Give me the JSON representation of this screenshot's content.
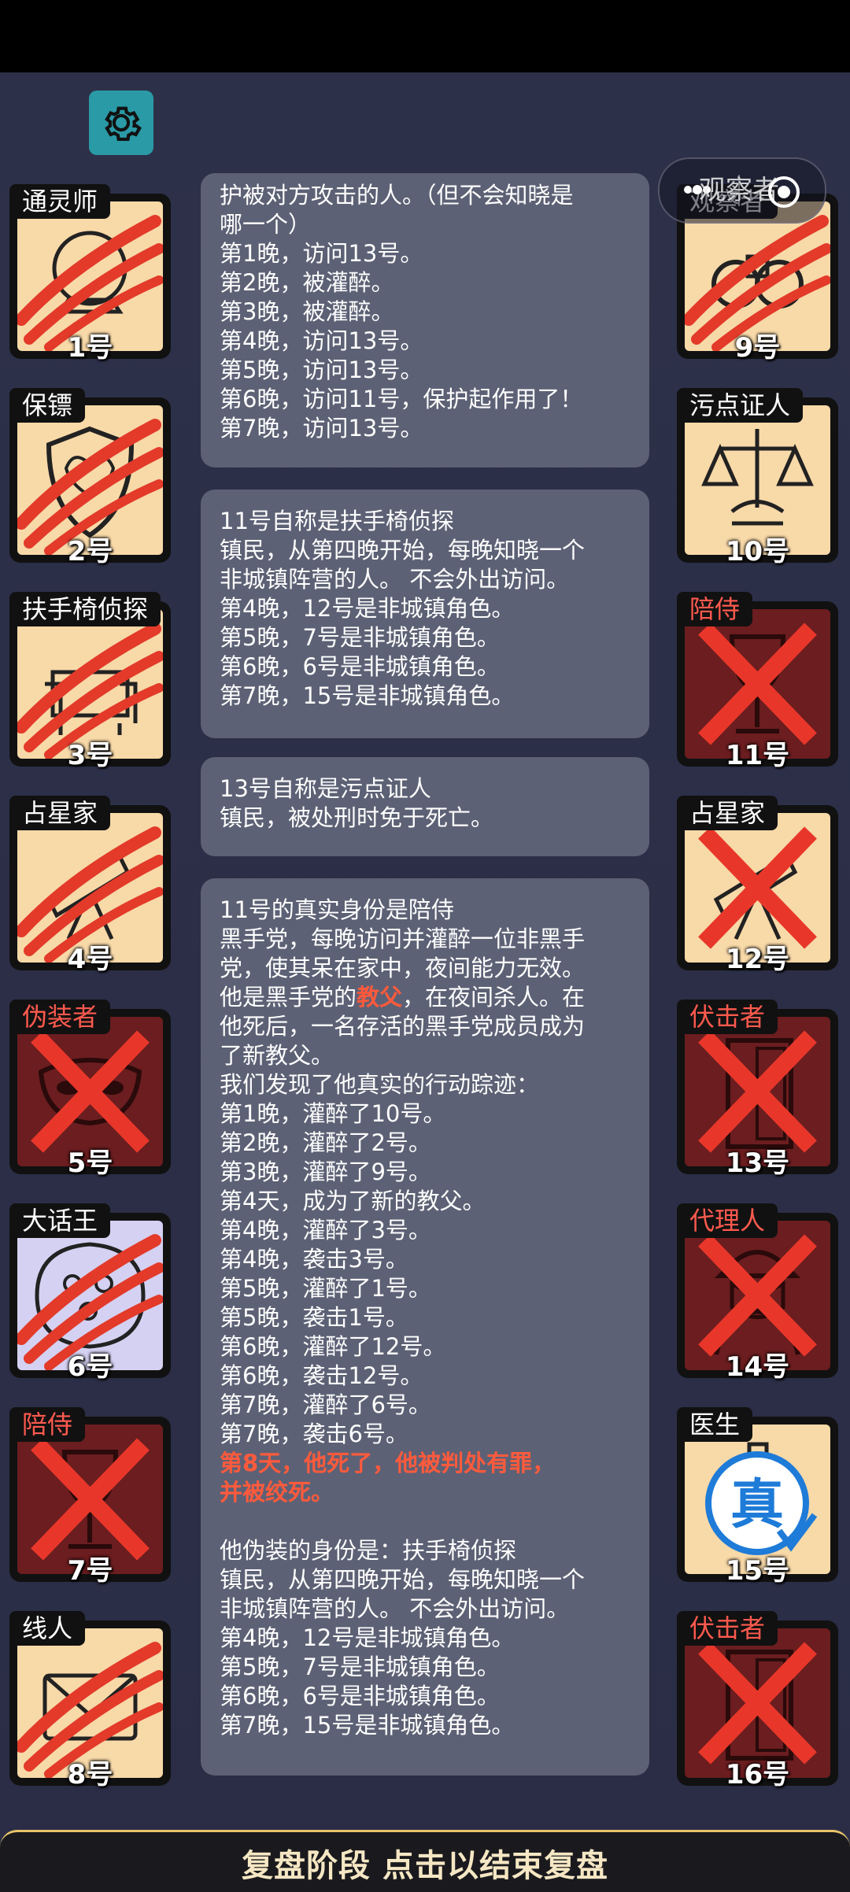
{
  "observer": {
    "label": "观察者"
  },
  "players_left": [
    {
      "num": "1号",
      "role": "通灵师",
      "evil": false,
      "state": "scratched",
      "icon": "crystal-ball-icon"
    },
    {
      "num": "2号",
      "role": "保镖",
      "evil": false,
      "state": "scratched",
      "icon": "shield-icon"
    },
    {
      "num": "3号",
      "role": "扶手椅侦探",
      "evil": false,
      "state": "scratched",
      "icon": "armchair-icon"
    },
    {
      "num": "4号",
      "role": "占星家",
      "evil": false,
      "state": "scratched",
      "icon": "telescope-icon"
    },
    {
      "num": "5号",
      "role": "伪装者",
      "evil": true,
      "state": "crossed",
      "icon": "mask-icon"
    },
    {
      "num": "6号",
      "role": "大话王",
      "evil": false,
      "state": "scratched",
      "icon": "speech-icon"
    },
    {
      "num": "7号",
      "role": "陪侍",
      "evil": true,
      "state": "crossed",
      "icon": "wine-glass-icon"
    },
    {
      "num": "8号",
      "role": "线人",
      "evil": false,
      "state": "scratched",
      "icon": "envelope-icon"
    }
  ],
  "players_right": [
    {
      "num": "9号",
      "role": "观察者",
      "evil": false,
      "state": "scratched",
      "icon": "binoculars-icon"
    },
    {
      "num": "10号",
      "role": "污点证人",
      "evil": false,
      "state": "alive",
      "icon": "scales-icon"
    },
    {
      "num": "11号",
      "role": "陪侍",
      "evil": true,
      "state": "crossed",
      "icon": "wine-glass-icon"
    },
    {
      "num": "12号",
      "role": "占星家",
      "evil": false,
      "state": "crossed",
      "icon": "telescope-icon"
    },
    {
      "num": "13号",
      "role": "伏击者",
      "evil": true,
      "state": "crossed",
      "icon": "door-icon"
    },
    {
      "num": "14号",
      "role": "代理人",
      "evil": true,
      "state": "crossed",
      "icon": "agent-icon"
    },
    {
      "num": "15号",
      "role": "医生",
      "evil": false,
      "state": "true-stamp",
      "icon": "syringe-icon",
      "stamp": "真"
    },
    {
      "num": "16号",
      "role": "伏击者",
      "evil": true,
      "state": "crossed",
      "icon": "door-icon"
    }
  ],
  "log": {
    "bubble1": [
      "护被对方攻击的人。（但不会知晓是",
      "哪一个）",
      "第1晚，访问13号。",
      "第2晚，被灌醉。",
      "第3晚，被灌醉。",
      "第4晚，访问13号。",
      "第5晚，访问13号。",
      "第6晚，访问11号，保护起作用了！",
      "第7晚，访问13号。"
    ],
    "bubble2": [
      "11号自称是扶手椅侦探",
      "镇民，从第四晚开始，每晚知晓一个",
      "非城镇阵营的人。 不会外出访问。",
      "第4晚，12号是非城镇角色。",
      "第5晚，7号是非城镇角色。",
      "第6晚，6号是非城镇角色。",
      "第7晚，15号是非城镇角色。"
    ],
    "bubble3": [
      "13号自称是污点证人",
      "镇民，被处刑时免于死亡。"
    ],
    "bubble4_head": [
      "11号的真实身份是陪侍",
      "黑手党，每晚访问并灌醉一位非黑手",
      "党，使其呆在家中，夜间能力无效。"
    ],
    "bubble4_godfather_pre": "他是黑手党的",
    "bubble4_godfather_word": "教父",
    "bubble4_godfather_post": "，在夜间杀人。在",
    "bubble4_mid": [
      "他死后，一名存活的黑手党成员成为",
      "了新教父。",
      "我们发现了他真实的行动踪迹：",
      "第1晚，灌醉了10号。",
      "第2晚，灌醉了2号。",
      "第3晚，灌醉了9号。",
      "第4天，成为了新的教父。",
      "第4晚，灌醉了3号。",
      "第4晚，袭击3号。",
      "第5晚，灌醉了1号。",
      "第5晚，袭击1号。",
      "第6晚，灌醉了12号。",
      "第6晚，袭击12号。",
      "第7晚，灌醉了6号。",
      "第7晚，袭击6号。"
    ],
    "bubble4_verdict": [
      "第8天，他死了，他被判处有罪，",
      "并被绞死。"
    ],
    "bubble4_tail": [
      "他伪装的身份是：扶手椅侦探",
      "镇民，从第四晚开始，每晚知晓一个",
      "非城镇阵营的人。 不会外出访问。",
      "第4晚，12号是非城镇角色。",
      "第5晚，7号是非城镇角色。",
      "第6晚，6号是非城镇角色。",
      "第7晚，15号是非城镇角色。"
    ]
  },
  "bottom_bar": {
    "label": "复盘阶段 点击以结束复盘"
  },
  "colors": {
    "evil_tag": "#ff5a4e",
    "alive_card": "#f8d9a8",
    "dead_card": "#6b1d1f",
    "highlight": "#ff5a3c",
    "bubble": "#5d6175"
  }
}
